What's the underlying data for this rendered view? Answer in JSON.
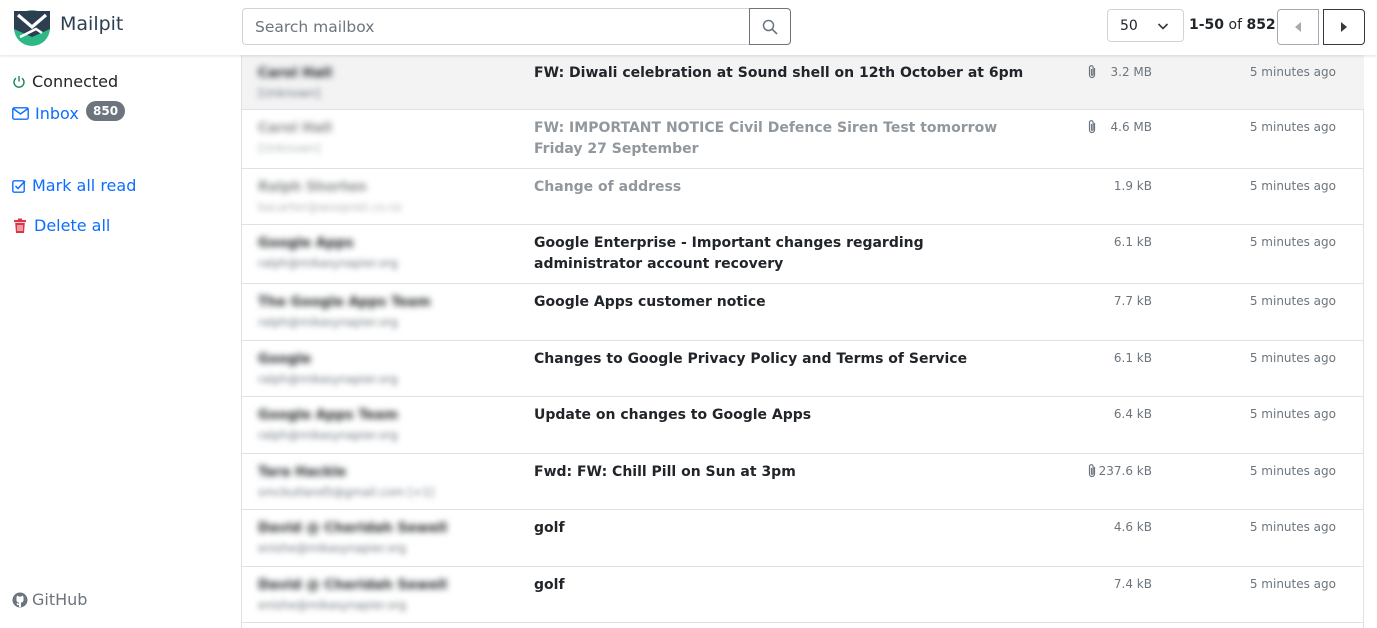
{
  "app": {
    "title": "Mailpit"
  },
  "search": {
    "placeholder": "Search mailbox"
  },
  "pagination": {
    "per_page": "50",
    "range": "1-50",
    "of_label": "of",
    "total": "852"
  },
  "sidebar": {
    "status": "Connected",
    "inbox_label": "Inbox",
    "inbox_count": "850",
    "mark_all_read": "Mark all read",
    "delete_all": "Delete all",
    "github": "GitHub"
  },
  "colors": {
    "accent": "#0d6efd",
    "logo_dark": "#2c3e50",
    "logo_green": "#2eb886",
    "danger": "#dc3545"
  },
  "messages": [
    {
      "from": "Carol Hall",
      "email": "[Unknown]",
      "subject": "FW: Diwali celebration at Sound shell on 12th October at 6pm",
      "attachment": true,
      "size": "3.2 MB",
      "time": "5 minutes ago"
    },
    {
      "from": "Carol Hall",
      "email": "[Unknown]",
      "subject": "FW: IMPORTANT NOTICE Civil Defence Siren Test tomorrow Friday 27 September",
      "attachment": true,
      "size": "4.6 MB",
      "time": "5 minutes ago"
    },
    {
      "from": "Ralph Shorten",
      "email": "bacarter@woopnet.co.nz",
      "subject": "Change of address",
      "attachment": false,
      "size": "1.9 kB",
      "time": "5 minutes ago"
    },
    {
      "from": "Google Apps",
      "email": "ralph@mikasynapier.org",
      "subject": "Google Enterprise - Important changes regarding administrator account recovery",
      "attachment": false,
      "size": "6.1 kB",
      "time": "5 minutes ago"
    },
    {
      "from": "The Google Apps Team",
      "email": "ralph@mikasynapier.org",
      "subject": "Google Apps customer notice",
      "attachment": false,
      "size": "7.7 kB",
      "time": "5 minutes ago"
    },
    {
      "from": "Google",
      "email": "ralph@mikasynapier.org",
      "subject": "Changes to Google Privacy Policy and Terms of Service",
      "attachment": false,
      "size": "6.1 kB",
      "time": "5 minutes ago"
    },
    {
      "from": "Google Apps Team",
      "email": "ralph@mikasynapier.org",
      "subject": "Update on changes to Google Apps",
      "attachment": false,
      "size": "6.4 kB",
      "time": "5 minutes ago"
    },
    {
      "from": "Tara Hackle",
      "email": "smcbutland5@gmail.com [+1]",
      "subject": "Fwd: FW: Chill Pill on Sun at 3pm",
      "attachment": true,
      "size": "237.6 kB",
      "time": "5 minutes ago"
    },
    {
      "from": "David @ Cheridah Sewell",
      "email": "enishe@mikasynapier.org",
      "subject": "golf",
      "attachment": false,
      "size": "4.6 kB",
      "time": "5 minutes ago"
    },
    {
      "from": "David @ Cheridah Sewell",
      "email": "enishe@mikasynapier.org",
      "subject": "golf",
      "attachment": false,
      "size": "7.4 kB",
      "time": "5 minutes ago"
    }
  ]
}
